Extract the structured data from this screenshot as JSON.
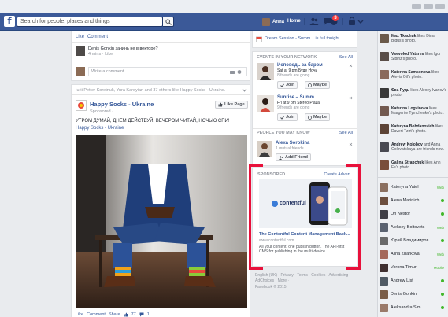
{
  "topbar": {
    "logo": "f",
    "search_placeholder": "Search for people, places and things",
    "user_name": "Anna",
    "home_label": "Home",
    "notifications_count": "3"
  },
  "feed": {
    "prev_post": {
      "actions": [
        "Like",
        "Comment"
      ],
      "comment": {
        "author": "Denis Gonkin",
        "text": "Denis Gonkin зачинь не в векторе?",
        "meta": "4 mins · Like"
      },
      "reply_placeholder": "Write a comment..."
    },
    "post": {
      "liked_by": "Iurii Petter Koretnuk, Yura Kardyian and 37 others like Happy Socks - Ukraine.",
      "page_name": "Happy Socks - Ukraine",
      "sponsored": "Sponsored ·",
      "like_page": "Like Page",
      "text": "УТРОМ ДУМАЙ, ДНЕМ ДЕЙСТВУЙ, ВЕЧЕРОМ ЧИТАЙ, НОЧЬЮ СПИ!",
      "hashtag": "Happy Socks - Ukraine",
      "actions": [
        "Like",
        "Comment",
        "Share"
      ],
      "reactions": "77",
      "comments": "1"
    }
  },
  "right": {
    "top_event": "Dream Session - Summ... is full tonight",
    "events_header": "EVENTS IN YOUR NETWORK",
    "see_all": "See All",
    "events": [
      {
        "title": "Исповедь за баром",
        "date": "Sat at 9 pm Буде Ночь",
        "meta": "8 friends are going",
        "join": "Join",
        "maybe": "Maybe"
      },
      {
        "title": "Sunrise – Summ...",
        "date": "Fri at 9 pm Stereo Plaza",
        "meta": "9 friends are going",
        "join": "Join",
        "maybe": "Maybe"
      }
    ],
    "pymk_header": "PEOPLE YOU MAY KNOW",
    "pymk_see_all": "See All",
    "pymk": {
      "name": "Alexa Sorokina",
      "mutual": "1 mutual friends",
      "add": "Add Friend"
    },
    "ad": {
      "sponsored": "SPONSORED",
      "create_ad": "Create Advert",
      "brand": "contentful",
      "title": "The Contentful Content Management Back...",
      "url": "www.contentful.com",
      "desc": "All your content, one publish button. The API-first CMS for publishing in the multi-device..."
    },
    "footer_links": "English (UK) · Privacy · Terms · Cookies · Advertising · AdChoices · More ·",
    "copyright": "Facebook © 2015"
  },
  "chat": {
    "ticker": [
      {
        "name": "Max Tkachuk",
        "text": "likes Dima Bigus's photo.",
        "color": "#6b5a4a"
      },
      {
        "name": "Vsevolod Yatsres",
        "text": "likes Igor Sibiriz's photo.",
        "color": "#5a4e48"
      },
      {
        "name": "Katerina Samsonova",
        "text": "likes Alevis Oil's photo.",
        "color": "#8a6a5c"
      },
      {
        "name": "Єва Рудь",
        "text": "likes Alexey Ivanov's photo.",
        "color": "#3a3a3a"
      },
      {
        "name": "Katerina Logvinova",
        "text": "likes Margerite Tymchenko's photo.",
        "color": "#735a50"
      },
      {
        "name": "Kateryna Bohdanovich",
        "text": "likes Davert Tzirt's photo.",
        "color": "#5d4436"
      },
      {
        "name": "Andrew Kolobov",
        "text": "and Anna Golovatskaya are friends now.",
        "color": "#4a4a52"
      },
      {
        "name": "Galina Strapchuk",
        "text": "likes Ann Fe's photo.",
        "color": "#7a4e3a"
      }
    ],
    "contacts": [
      {
        "name": "Kateryna Yatel",
        "status": "Web",
        "color": "#8b7060"
      },
      {
        "name": "Alena Marinich",
        "status": "",
        "color": "#6c4e3e"
      },
      {
        "name": "Oh Nestor",
        "status": "",
        "color": "#3f3f46"
      },
      {
        "name": "Aleksey Boltovets",
        "status": "Web",
        "color": "#5a6270"
      },
      {
        "name": "Юрий Владимиров",
        "status": "",
        "color": "#6a6a6a"
      },
      {
        "name": "Alina Zharkova",
        "status": "Web",
        "color": "#a5685a"
      },
      {
        "name": "Vorona Timur",
        "status": "Mobile",
        "color": "#403030"
      },
      {
        "name": "Andrew List",
        "status": "",
        "color": "#505a64"
      },
      {
        "name": "Denis Gonkin",
        "status": "",
        "color": "#7a5d48"
      },
      {
        "name": "Aleksandra Sim...",
        "status": "",
        "color": "#9a7a6a"
      }
    ]
  }
}
